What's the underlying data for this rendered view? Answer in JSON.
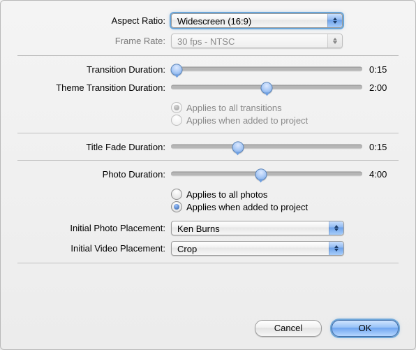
{
  "aspect_ratio": {
    "label": "Aspect Ratio:",
    "value": "Widescreen (16:9)"
  },
  "frame_rate": {
    "label": "Frame Rate:",
    "value": "30 fps - NTSC"
  },
  "transition_duration": {
    "label": "Transition Duration:",
    "value": "0:15",
    "position_pct": 3
  },
  "theme_transition_duration": {
    "label": "Theme Transition Duration:",
    "value": "2:00",
    "position_pct": 50
  },
  "transition_scope": {
    "all": "Applies to all transitions",
    "added": "Applies when added to project"
  },
  "title_fade_duration": {
    "label": "Title Fade Duration:",
    "value": "0:15",
    "position_pct": 35
  },
  "photo_duration": {
    "label": "Photo Duration:",
    "value": "4:00",
    "position_pct": 47
  },
  "photo_scope": {
    "all": "Applies to all photos",
    "added": "Applies when added to project"
  },
  "initial_photo_placement": {
    "label": "Initial Photo Placement:",
    "value": "Ken Burns"
  },
  "initial_video_placement": {
    "label": "Initial Video Placement:",
    "value": "Crop"
  },
  "buttons": {
    "cancel": "Cancel",
    "ok": "OK"
  }
}
